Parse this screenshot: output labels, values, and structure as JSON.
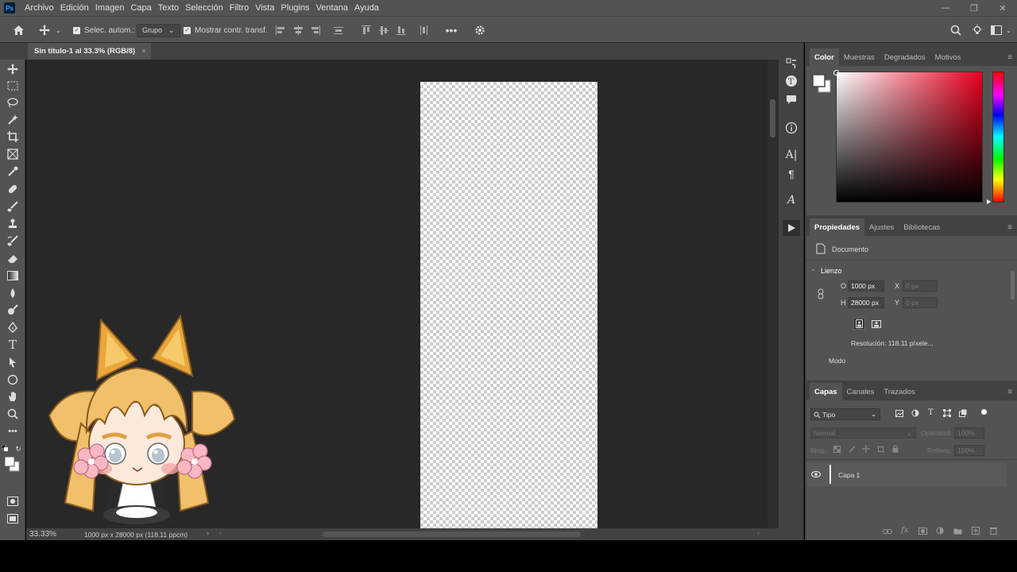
{
  "menubar": {
    "logo": "Ps",
    "items": [
      "Archivo",
      "Edición",
      "Imagen",
      "Capa",
      "Texto",
      "Selección",
      "Filtro",
      "Vista",
      "Plugins",
      "Ventana",
      "Ayuda"
    ]
  },
  "options": {
    "auto_select_label": "Selec. autom.:",
    "auto_select_value": "Grupo",
    "show_transform_label": "Mostrar contr. transf."
  },
  "document": {
    "tab_title": "Sin título-1 al 33.3% (RGB/8)"
  },
  "status": {
    "zoom": "33.33%",
    "doc_info": "1000 px x 28000 px (118.11 ppcm)"
  },
  "color_panel": {
    "tabs": [
      "Color",
      "Muestras",
      "Degradados",
      "Motivos"
    ],
    "accent": "#e8001f"
  },
  "properties_panel": {
    "tabs": [
      "Propiedades",
      "Ajustes",
      "Bibliotecas"
    ],
    "doc_label": "Documento",
    "section": "Lienzo",
    "w_label": "O",
    "w_value": "1000 px",
    "h_label": "H",
    "h_value": "28000 px",
    "x_label": "X",
    "x_value": "0 px",
    "y_label": "Y",
    "y_value": "0 px",
    "resolution": "Resolución: 118.11 píxele...",
    "mode": "Modo"
  },
  "layers_panel": {
    "tabs": [
      "Capas",
      "Canales",
      "Trazados"
    ],
    "filter": "Tipo",
    "blend_mode": "Normal",
    "opacity_label": "Opacidad:",
    "opacity_value": "100%",
    "lock_label": "Bloq.:",
    "fill_label": "Relleno:",
    "fill_value": "100%",
    "layer_name": "Capa 1"
  }
}
